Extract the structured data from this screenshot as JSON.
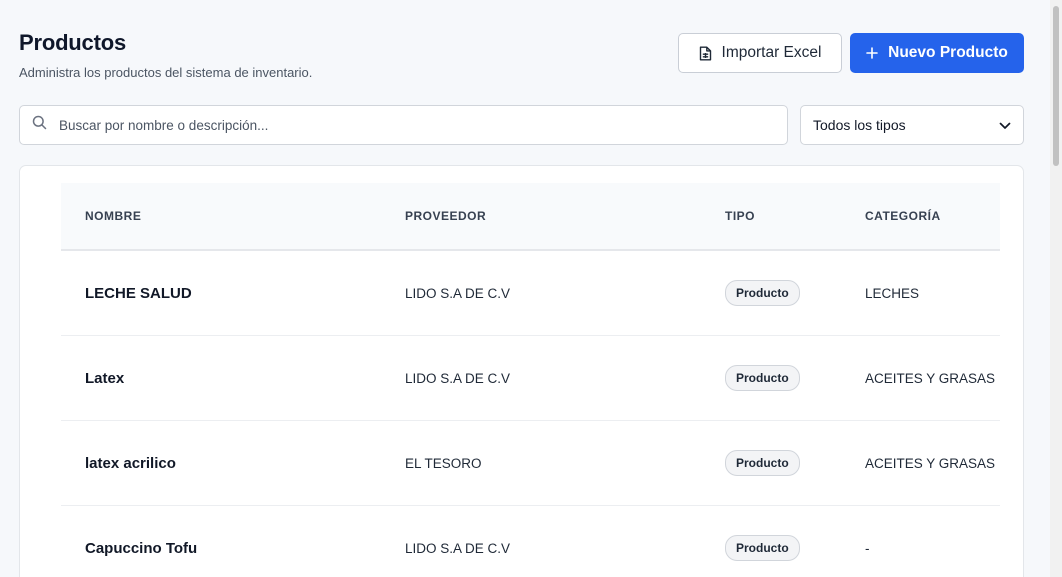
{
  "header": {
    "title": "Productos",
    "subtitle": "Administra los productos del sistema de inventario."
  },
  "actions": {
    "import_label": "Importar Excel",
    "new_label": "Nuevo Producto"
  },
  "search": {
    "placeholder": "Buscar por nombre o descripción...",
    "value": ""
  },
  "filter": {
    "selected": "Todos los tipos"
  },
  "table": {
    "columns": [
      "NOMBRE",
      "PROVEEDOR",
      "TIPO",
      "CATEGORÍA"
    ],
    "rows": [
      {
        "name": "LECHE SALUD",
        "supplier": "LIDO S.A DE C.V",
        "type": "Producto",
        "category": "LECHES"
      },
      {
        "name": "Latex",
        "supplier": "LIDO S.A DE C.V",
        "type": "Producto",
        "category": "ACEITES Y GRASAS"
      },
      {
        "name": "latex acrilico",
        "supplier": "EL TESORO",
        "type": "Producto",
        "category": "ACEITES Y GRASAS"
      },
      {
        "name": "Capuccino Tofu",
        "supplier": "LIDO S.A DE C.V",
        "type": "Producto",
        "category": "-"
      }
    ]
  },
  "icons": {
    "import": "file-spreadsheet-icon",
    "new": "plus-icon",
    "search": "search-icon",
    "select": "chevron-down-icon"
  },
  "colors": {
    "primary": "#2563eb",
    "background": "#f6f8fb"
  }
}
